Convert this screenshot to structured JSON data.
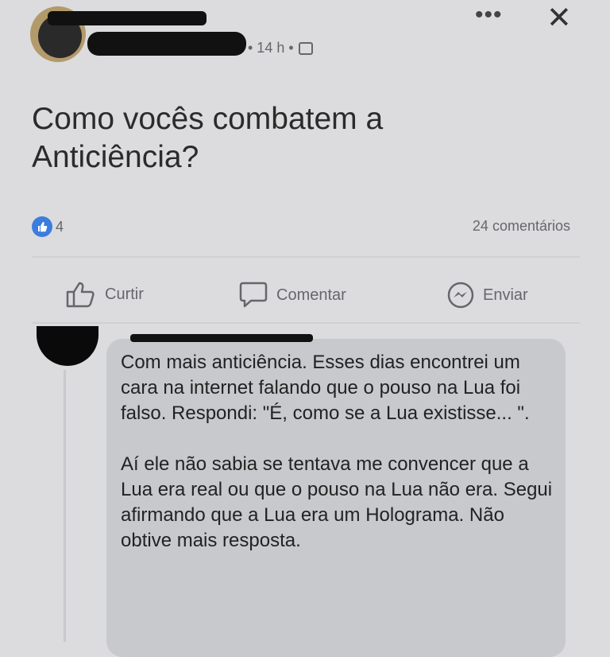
{
  "post": {
    "meta": "• 14 h •",
    "text": "Como vocês combatem a Anticiência?",
    "more_label": "•••",
    "close_label": "✕",
    "reaction_count": "4",
    "comment_count": "24 comentários"
  },
  "actions": {
    "like_label": "Curtir",
    "comment_label": "Comentar",
    "send_label": "Enviar"
  },
  "comment": {
    "paragraph_1": "Com mais anticiência. Esses dias encontrei um cara na internet falando que o pouso na Lua foi falso. Respondi: \"É, como se a Lua existisse... \".",
    "paragraph_2": "Aí ele não sabia se tentava me convencer que a Lua era real ou que o pouso na Lua não era. Segui afirmando que a Lua era um Holograma. Não obtive mais resposta."
  },
  "colors": {
    "background": "#dcdcde",
    "like_blue": "#3b7ddd",
    "secondary_text": "#65676b",
    "comment_bubble": "#c8c9cd"
  },
  "icons": {
    "like": "thumbs-up-icon",
    "comment": "speech-bubble-icon",
    "send": "messenger-icon",
    "privacy": "globe-icon"
  }
}
